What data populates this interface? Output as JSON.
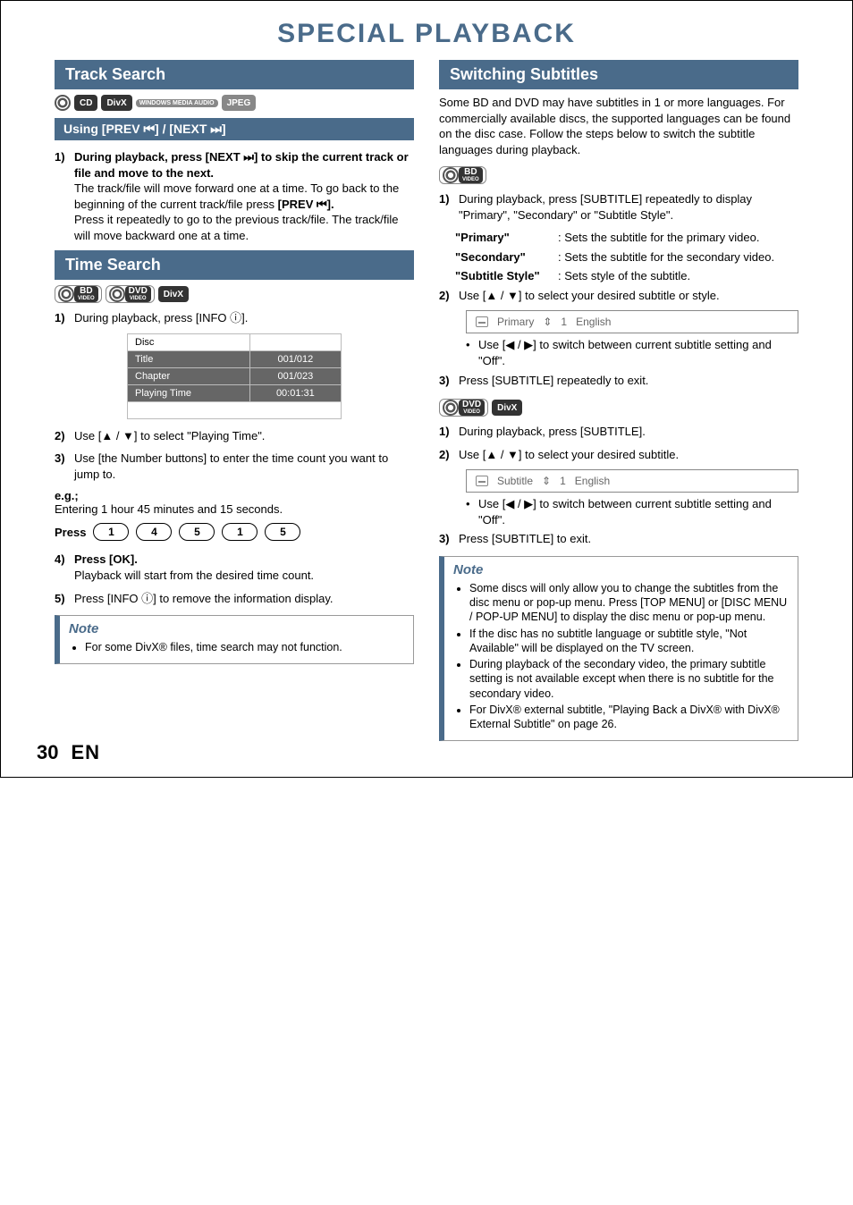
{
  "page_title": "SPECIAL PLAYBACK",
  "footer": {
    "page_number": "30",
    "lang": "EN"
  },
  "left": {
    "track_search": {
      "heading": "Track Search",
      "badges": [
        "CD",
        "DivX",
        "WINDOWS MEDIA AUDIO",
        "JPEG"
      ],
      "sub_heading": "Using [PREV ⏮] / [NEXT ⏭]",
      "steps": [
        {
          "num": "1)",
          "bold": "During playback, press [NEXT ⏭] to skip the current track or file and move to the next.",
          "paras": [
            "The track/file will move forward one at a time. To go back to the beginning of the current track/file press",
            "[PREV ⏮].",
            "Press it repeatedly to go to the previous track/file. The track/file will move backward one at a time."
          ]
        }
      ]
    },
    "time_search": {
      "heading": "Time Search",
      "badges": [
        "BD VIDEO",
        "DVD VIDEO",
        "DivX"
      ],
      "step1": {
        "num": "1)",
        "bold": "During playback, press [INFO ⓘ]."
      },
      "table": {
        "rows": [
          {
            "label": "Disc",
            "value": ""
          },
          {
            "label": "Title",
            "value": "001/012"
          },
          {
            "label": "Chapter",
            "value": "001/023"
          },
          {
            "label": "Playing Time",
            "value": "00:01:31"
          }
        ]
      },
      "step2": {
        "num": "2)",
        "bold": "Use [▲ / ▼] to select \"Playing Time\"."
      },
      "step3": {
        "num": "3)",
        "bold": "Use [the Number buttons] to enter the time count you want to jump to."
      },
      "eg_label": "e.g.;",
      "eg_text": "Entering 1 hour 45 minutes and 15 seconds.",
      "press_label": "Press",
      "keys": [
        "1",
        "4",
        "5",
        "1",
        "5"
      ],
      "step4": {
        "num": "4)",
        "bold": "Press [OK].",
        "para": "Playback will start from the desired time count."
      },
      "step5": {
        "num": "5)",
        "bold": "Press [INFO ⓘ] to remove the information display."
      },
      "note": {
        "title": "Note",
        "items": [
          "For some DivX® files, time search may not function."
        ]
      }
    }
  },
  "right": {
    "heading": "Switching Subtitles",
    "intro": "Some BD and DVD may have subtitles in 1 or more languages. For commercially available discs, the supported languages can be found on the disc case. Follow the steps below to switch the subtitle languages during playback.",
    "bd": {
      "badges": [
        "BD VIDEO"
      ],
      "step1": {
        "num": "1)",
        "bold": "During playback, press [SUBTITLE] repeatedly to display \"Primary\", \"Secondary\" or \"Subtitle Style\"."
      },
      "defs": [
        {
          "term": "\"Primary\"",
          "desc": ": Sets the subtitle for the primary video."
        },
        {
          "term": "\"Secondary\"",
          "desc": ": Sets the subtitle for the secondary video."
        },
        {
          "term": "\"Subtitle Style\"",
          "desc": ": Sets style of the subtitle."
        }
      ],
      "step2": {
        "num": "2)",
        "bold": "Use [▲ / ▼] to select your desired subtitle or style."
      },
      "osd": {
        "label": "Primary",
        "index": "1",
        "lang": "English"
      },
      "bullet": "Use [◀ / ▶] to switch between current subtitle setting and \"Off\".",
      "step3": {
        "num": "3)",
        "bold": "Press [SUBTITLE] repeatedly to exit."
      }
    },
    "dvd": {
      "badges": [
        "DVD VIDEO",
        "DivX"
      ],
      "step1": {
        "num": "1)",
        "bold": "During playback, press [SUBTITLE]."
      },
      "step2": {
        "num": "2)",
        "bold": "Use [▲ / ▼] to select your desired subtitle."
      },
      "osd": {
        "label": "Subtitle",
        "index": "1",
        "lang": "English"
      },
      "bullet": "Use [◀ / ▶] to switch between current subtitle setting and \"Off\".",
      "step3": {
        "num": "3)",
        "bold": "Press [SUBTITLE] to exit."
      }
    },
    "note": {
      "title": "Note",
      "items": [
        "Some discs will only allow you to change the subtitles from the disc menu or pop-up menu. Press [TOP MENU] or [DISC MENU / POP-UP MENU] to display the disc menu or pop-up menu.",
        "If the disc has no subtitle language or subtitle style, \"Not Available\" will be displayed on the TV screen.",
        "During playback of the secondary video, the primary subtitle setting is not available except when there is no subtitle for the secondary video.",
        "For DivX® external subtitle, \"Playing Back a DivX® with DivX® External Subtitle\" on page 26."
      ]
    }
  }
}
